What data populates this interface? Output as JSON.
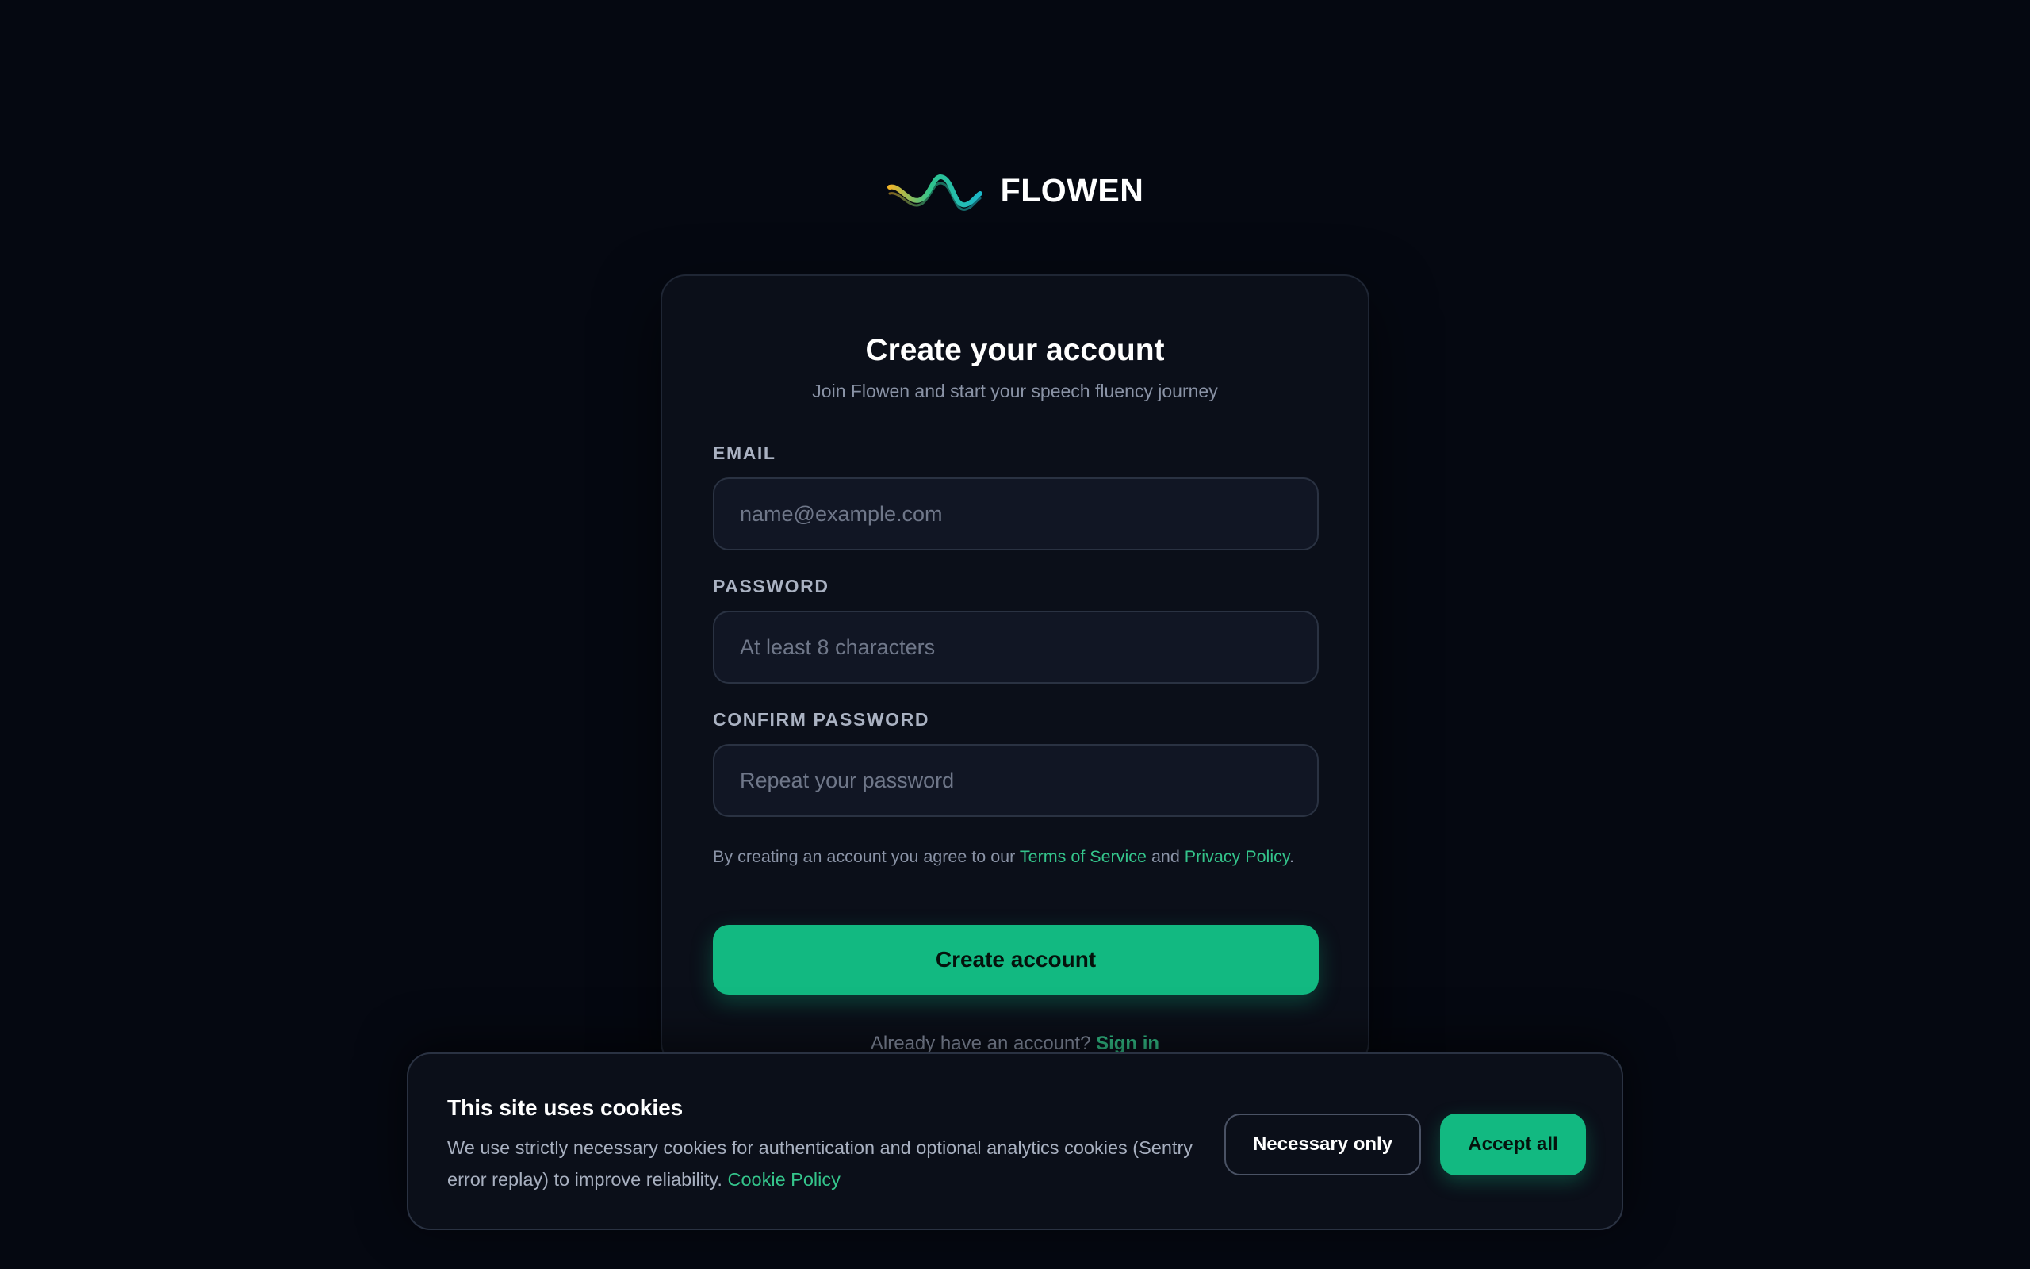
{
  "brand": {
    "name": "FLOWEN",
    "icon": "wave-logo-icon",
    "gradient_colors": [
      "#f0b429",
      "#2fc48d",
      "#1cb7c9"
    ]
  },
  "signup": {
    "title": "Create your account",
    "subtitle": "Join Flowen and start your speech fluency journey",
    "email": {
      "label": "EMAIL",
      "placeholder": "name@example.com",
      "value": ""
    },
    "password": {
      "label": "PASSWORD",
      "placeholder": "At least 8 characters",
      "value": ""
    },
    "confirm_password": {
      "label": "CONFIRM PASSWORD",
      "placeholder": "Repeat your password",
      "value": ""
    },
    "terms": {
      "prefix": "By creating an account you agree to our ",
      "terms_link": "Terms of Service",
      "middle": " and ",
      "privacy_link": "Privacy Policy",
      "suffix": "."
    },
    "submit_label": "Create account",
    "signin_prompt": "Already have an account?",
    "signin_link": "Sign in"
  },
  "cookie_banner": {
    "title": "This site uses cookies",
    "text": "We use strictly necessary cookies for authentication and optional analytics cookies (Sentry error replay) to improve reliability.",
    "policy_link": "Cookie Policy",
    "necessary_label": "Necessary only",
    "accept_label": "Accept all"
  },
  "colors": {
    "background": "#050811",
    "card": "#0b0f19",
    "accent": "#12b981",
    "link": "#34c48b",
    "muted_text": "#8a93a6"
  }
}
